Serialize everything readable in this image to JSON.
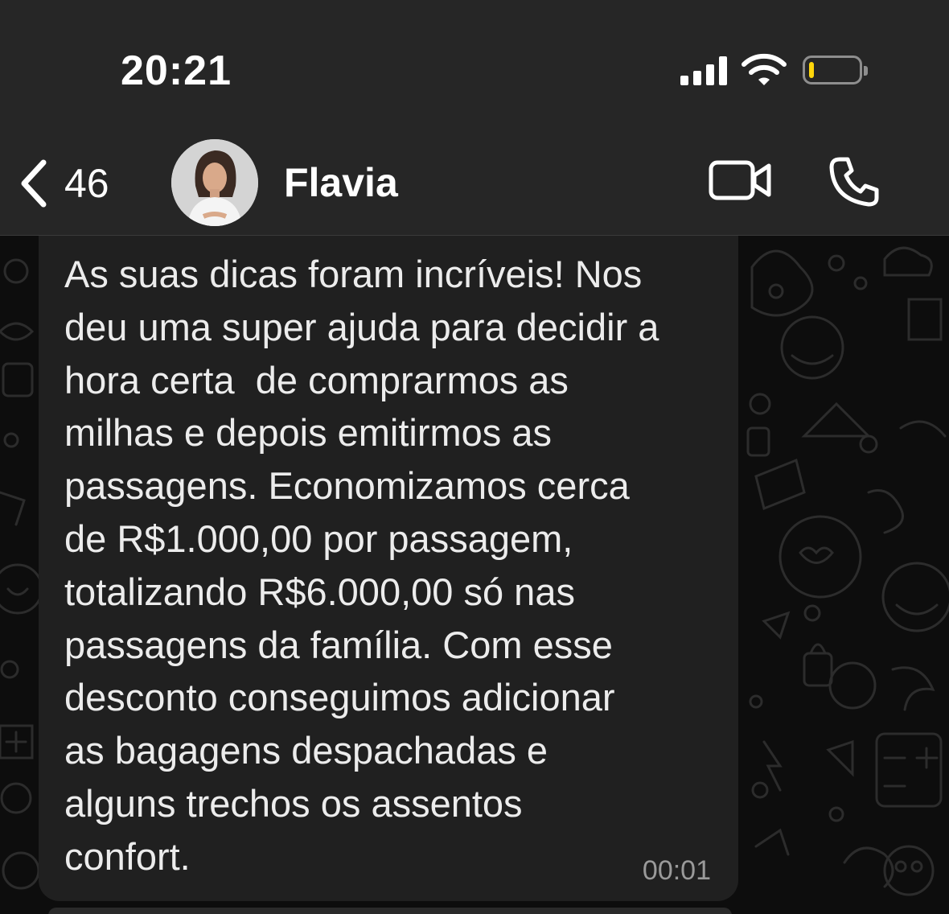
{
  "status_bar": {
    "time": "20:21",
    "signal_icon": "cellular-signal-icon",
    "wifi_icon": "wifi-icon",
    "battery_icon": "battery-icon",
    "battery_level_fraction": 0.1,
    "battery_color": "#ffd60a"
  },
  "header": {
    "back_icon": "chevron-left-icon",
    "unread_count": "46",
    "contact_name": "Flavia",
    "video_icon": "video-camera-icon",
    "call_icon": "phone-icon",
    "background_color": "#262626"
  },
  "message": {
    "text": "As suas dicas foram incríveis! Nos\ndeu uma super ajuda para decidir a\nhora certa  de comprarmos as\nmilhas e depois emitirmos as\npassagens. Economizamos cerca\nde R$1.000,00 por passagem,\ntotalizando R$6.000,00 só nas\npassagens da família. Com esse\ndesconto conseguimos adicionar\nas bagagens despachadas e\nalguns trechos os assentos\nconfort.",
    "time": "00:01",
    "bubble_color": "#202020",
    "text_color": "#ececec"
  }
}
